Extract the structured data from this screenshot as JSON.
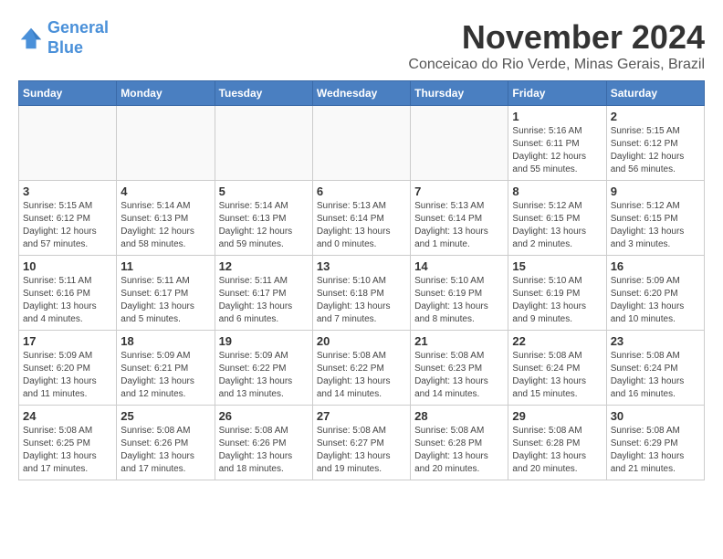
{
  "logo": {
    "line1": "General",
    "line2": "Blue"
  },
  "title": "November 2024",
  "subtitle": "Conceicao do Rio Verde, Minas Gerais, Brazil",
  "weekdays": [
    "Sunday",
    "Monday",
    "Tuesday",
    "Wednesday",
    "Thursday",
    "Friday",
    "Saturday"
  ],
  "weeks": [
    [
      {
        "day": "",
        "info": ""
      },
      {
        "day": "",
        "info": ""
      },
      {
        "day": "",
        "info": ""
      },
      {
        "day": "",
        "info": ""
      },
      {
        "day": "",
        "info": ""
      },
      {
        "day": "1",
        "info": "Sunrise: 5:16 AM\nSunset: 6:11 PM\nDaylight: 12 hours\nand 55 minutes."
      },
      {
        "day": "2",
        "info": "Sunrise: 5:15 AM\nSunset: 6:12 PM\nDaylight: 12 hours\nand 56 minutes."
      }
    ],
    [
      {
        "day": "3",
        "info": "Sunrise: 5:15 AM\nSunset: 6:12 PM\nDaylight: 12 hours\nand 57 minutes."
      },
      {
        "day": "4",
        "info": "Sunrise: 5:14 AM\nSunset: 6:13 PM\nDaylight: 12 hours\nand 58 minutes."
      },
      {
        "day": "5",
        "info": "Sunrise: 5:14 AM\nSunset: 6:13 PM\nDaylight: 12 hours\nand 59 minutes."
      },
      {
        "day": "6",
        "info": "Sunrise: 5:13 AM\nSunset: 6:14 PM\nDaylight: 13 hours\nand 0 minutes."
      },
      {
        "day": "7",
        "info": "Sunrise: 5:13 AM\nSunset: 6:14 PM\nDaylight: 13 hours\nand 1 minute."
      },
      {
        "day": "8",
        "info": "Sunrise: 5:12 AM\nSunset: 6:15 PM\nDaylight: 13 hours\nand 2 minutes."
      },
      {
        "day": "9",
        "info": "Sunrise: 5:12 AM\nSunset: 6:15 PM\nDaylight: 13 hours\nand 3 minutes."
      }
    ],
    [
      {
        "day": "10",
        "info": "Sunrise: 5:11 AM\nSunset: 6:16 PM\nDaylight: 13 hours\nand 4 minutes."
      },
      {
        "day": "11",
        "info": "Sunrise: 5:11 AM\nSunset: 6:17 PM\nDaylight: 13 hours\nand 5 minutes."
      },
      {
        "day": "12",
        "info": "Sunrise: 5:11 AM\nSunset: 6:17 PM\nDaylight: 13 hours\nand 6 minutes."
      },
      {
        "day": "13",
        "info": "Sunrise: 5:10 AM\nSunset: 6:18 PM\nDaylight: 13 hours\nand 7 minutes."
      },
      {
        "day": "14",
        "info": "Sunrise: 5:10 AM\nSunset: 6:19 PM\nDaylight: 13 hours\nand 8 minutes."
      },
      {
        "day": "15",
        "info": "Sunrise: 5:10 AM\nSunset: 6:19 PM\nDaylight: 13 hours\nand 9 minutes."
      },
      {
        "day": "16",
        "info": "Sunrise: 5:09 AM\nSunset: 6:20 PM\nDaylight: 13 hours\nand 10 minutes."
      }
    ],
    [
      {
        "day": "17",
        "info": "Sunrise: 5:09 AM\nSunset: 6:20 PM\nDaylight: 13 hours\nand 11 minutes."
      },
      {
        "day": "18",
        "info": "Sunrise: 5:09 AM\nSunset: 6:21 PM\nDaylight: 13 hours\nand 12 minutes."
      },
      {
        "day": "19",
        "info": "Sunrise: 5:09 AM\nSunset: 6:22 PM\nDaylight: 13 hours\nand 13 minutes."
      },
      {
        "day": "20",
        "info": "Sunrise: 5:08 AM\nSunset: 6:22 PM\nDaylight: 13 hours\nand 14 minutes."
      },
      {
        "day": "21",
        "info": "Sunrise: 5:08 AM\nSunset: 6:23 PM\nDaylight: 13 hours\nand 14 minutes."
      },
      {
        "day": "22",
        "info": "Sunrise: 5:08 AM\nSunset: 6:24 PM\nDaylight: 13 hours\nand 15 minutes."
      },
      {
        "day": "23",
        "info": "Sunrise: 5:08 AM\nSunset: 6:24 PM\nDaylight: 13 hours\nand 16 minutes."
      }
    ],
    [
      {
        "day": "24",
        "info": "Sunrise: 5:08 AM\nSunset: 6:25 PM\nDaylight: 13 hours\nand 17 minutes."
      },
      {
        "day": "25",
        "info": "Sunrise: 5:08 AM\nSunset: 6:26 PM\nDaylight: 13 hours\nand 17 minutes."
      },
      {
        "day": "26",
        "info": "Sunrise: 5:08 AM\nSunset: 6:26 PM\nDaylight: 13 hours\nand 18 minutes."
      },
      {
        "day": "27",
        "info": "Sunrise: 5:08 AM\nSunset: 6:27 PM\nDaylight: 13 hours\nand 19 minutes."
      },
      {
        "day": "28",
        "info": "Sunrise: 5:08 AM\nSunset: 6:28 PM\nDaylight: 13 hours\nand 20 minutes."
      },
      {
        "day": "29",
        "info": "Sunrise: 5:08 AM\nSunset: 6:28 PM\nDaylight: 13 hours\nand 20 minutes."
      },
      {
        "day": "30",
        "info": "Sunrise: 5:08 AM\nSunset: 6:29 PM\nDaylight: 13 hours\nand 21 minutes."
      }
    ]
  ]
}
